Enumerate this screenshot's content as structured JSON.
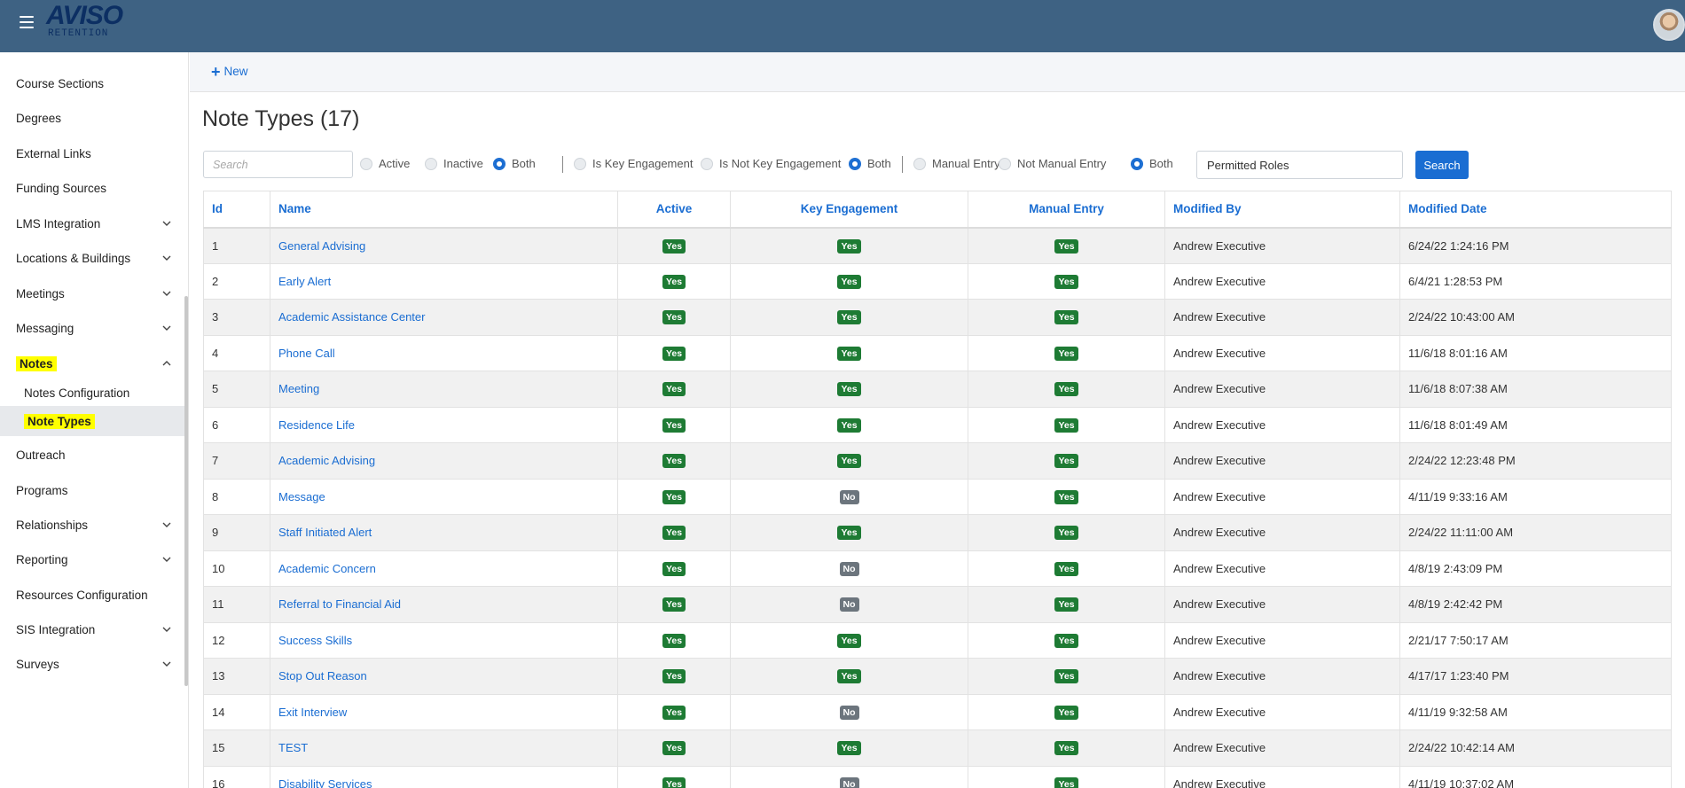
{
  "app": {
    "logo_main": "AVISO",
    "logo_sub": "RETENTION",
    "menu_icon": "hamburger-icon",
    "avatar_icon": "user-avatar"
  },
  "sidebar": {
    "items": [
      {
        "label": "Course Sections",
        "chevron": false
      },
      {
        "label": "Degrees",
        "chevron": false
      },
      {
        "label": "External Links",
        "chevron": false
      },
      {
        "label": "Funding Sources",
        "chevron": false
      },
      {
        "label": "LMS Integration",
        "chevron": "down"
      },
      {
        "label": "Locations & Buildings",
        "chevron": "down"
      },
      {
        "label": "Meetings",
        "chevron": "down"
      },
      {
        "label": "Messaging",
        "chevron": "down"
      },
      {
        "label": "Notes",
        "chevron": "up"
      },
      {
        "label": "Notes Configuration",
        "chevron": false
      },
      {
        "label": "Note Types",
        "chevron": false
      },
      {
        "label": "Outreach",
        "chevron": false
      },
      {
        "label": "Programs",
        "chevron": false
      },
      {
        "label": "Relationships",
        "chevron": "down"
      },
      {
        "label": "Reporting",
        "chevron": "down"
      },
      {
        "label": "Resources Configuration",
        "chevron": false
      },
      {
        "label": "SIS Integration",
        "chevron": "down"
      },
      {
        "label": "Surveys",
        "chevron": "down"
      }
    ]
  },
  "toolbar": {
    "new_label": "New"
  },
  "page": {
    "title": "Note Types (17)"
  },
  "filters": {
    "search_placeholder": "Search",
    "active": "Active",
    "inactive": "Inactive",
    "both1": "Both",
    "is_key": "Is Key Engagement",
    "is_not_key": "Is Not Key Engagement",
    "both2": "Both",
    "manual": "Manual Entry",
    "not_manual": "Not Manual Entry",
    "both3": "Both",
    "roles_value": "Permitted Roles",
    "search_button": "Search"
  },
  "table": {
    "headers": [
      "Id",
      "Name",
      "Active",
      "Key Engagement",
      "Manual Entry",
      "Modified By",
      "Modified Date"
    ],
    "rows": [
      {
        "id": "1",
        "name": "General Advising",
        "active": "Yes",
        "key": "Yes",
        "manual": "Yes",
        "by": "Andrew Executive",
        "date": "6/24/22 1:24:16 PM"
      },
      {
        "id": "2",
        "name": "Early Alert",
        "active": "Yes",
        "key": "Yes",
        "manual": "Yes",
        "by": "Andrew Executive",
        "date": "6/4/21 1:28:53 PM"
      },
      {
        "id": "3",
        "name": "Academic Assistance Center",
        "active": "Yes",
        "key": "Yes",
        "manual": "Yes",
        "by": "Andrew Executive",
        "date": "2/24/22 10:43:00 AM"
      },
      {
        "id": "4",
        "name": "Phone Call",
        "active": "Yes",
        "key": "Yes",
        "manual": "Yes",
        "by": "Andrew Executive",
        "date": "11/6/18 8:01:16 AM"
      },
      {
        "id": "5",
        "name": "Meeting",
        "active": "Yes",
        "key": "Yes",
        "manual": "Yes",
        "by": "Andrew Executive",
        "date": "11/6/18 8:07:38 AM"
      },
      {
        "id": "6",
        "name": "Residence Life",
        "active": "Yes",
        "key": "Yes",
        "manual": "Yes",
        "by": "Andrew Executive",
        "date": "11/6/18 8:01:49 AM"
      },
      {
        "id": "7",
        "name": "Academic Advising",
        "active": "Yes",
        "key": "Yes",
        "manual": "Yes",
        "by": "Andrew Executive",
        "date": "2/24/22 12:23:48 PM"
      },
      {
        "id": "8",
        "name": "Message",
        "active": "Yes",
        "key": "No",
        "manual": "Yes",
        "by": "Andrew Executive",
        "date": "4/11/19 9:33:16 AM"
      },
      {
        "id": "9",
        "name": "Staff Initiated Alert",
        "active": "Yes",
        "key": "Yes",
        "manual": "Yes",
        "by": "Andrew Executive",
        "date": "2/24/22 11:11:00 AM"
      },
      {
        "id": "10",
        "name": "Academic Concern",
        "active": "Yes",
        "key": "No",
        "manual": "Yes",
        "by": "Andrew Executive",
        "date": "4/8/19 2:43:09 PM"
      },
      {
        "id": "11",
        "name": "Referral to Financial Aid",
        "active": "Yes",
        "key": "No",
        "manual": "Yes",
        "by": "Andrew Executive",
        "date": "4/8/19 2:42:42 PM"
      },
      {
        "id": "12",
        "name": "Success Skills",
        "active": "Yes",
        "key": "Yes",
        "manual": "Yes",
        "by": "Andrew Executive",
        "date": "2/21/17 7:50:17 AM"
      },
      {
        "id": "13",
        "name": "Stop Out Reason",
        "active": "Yes",
        "key": "Yes",
        "manual": "Yes",
        "by": "Andrew Executive",
        "date": "4/17/17 1:23:40 PM"
      },
      {
        "id": "14",
        "name": "Exit Interview",
        "active": "Yes",
        "key": "No",
        "manual": "Yes",
        "by": "Andrew Executive",
        "date": "4/11/19 9:32:58 AM"
      },
      {
        "id": "15",
        "name": "TEST",
        "active": "Yes",
        "key": "Yes",
        "manual": "Yes",
        "by": "Andrew Executive",
        "date": "2/24/22 10:42:14 AM"
      },
      {
        "id": "16",
        "name": "Disability Services",
        "active": "Yes",
        "key": "No",
        "manual": "Yes",
        "by": "Andrew Executive",
        "date": "4/11/19 10:37:02 AM"
      }
    ]
  },
  "colors": {
    "header_bg": "#3e6283",
    "accent": "#1a6dd2",
    "yes_badge": "#1e7b34",
    "no_badge": "#6c757d",
    "highlight": "#ffff00"
  }
}
